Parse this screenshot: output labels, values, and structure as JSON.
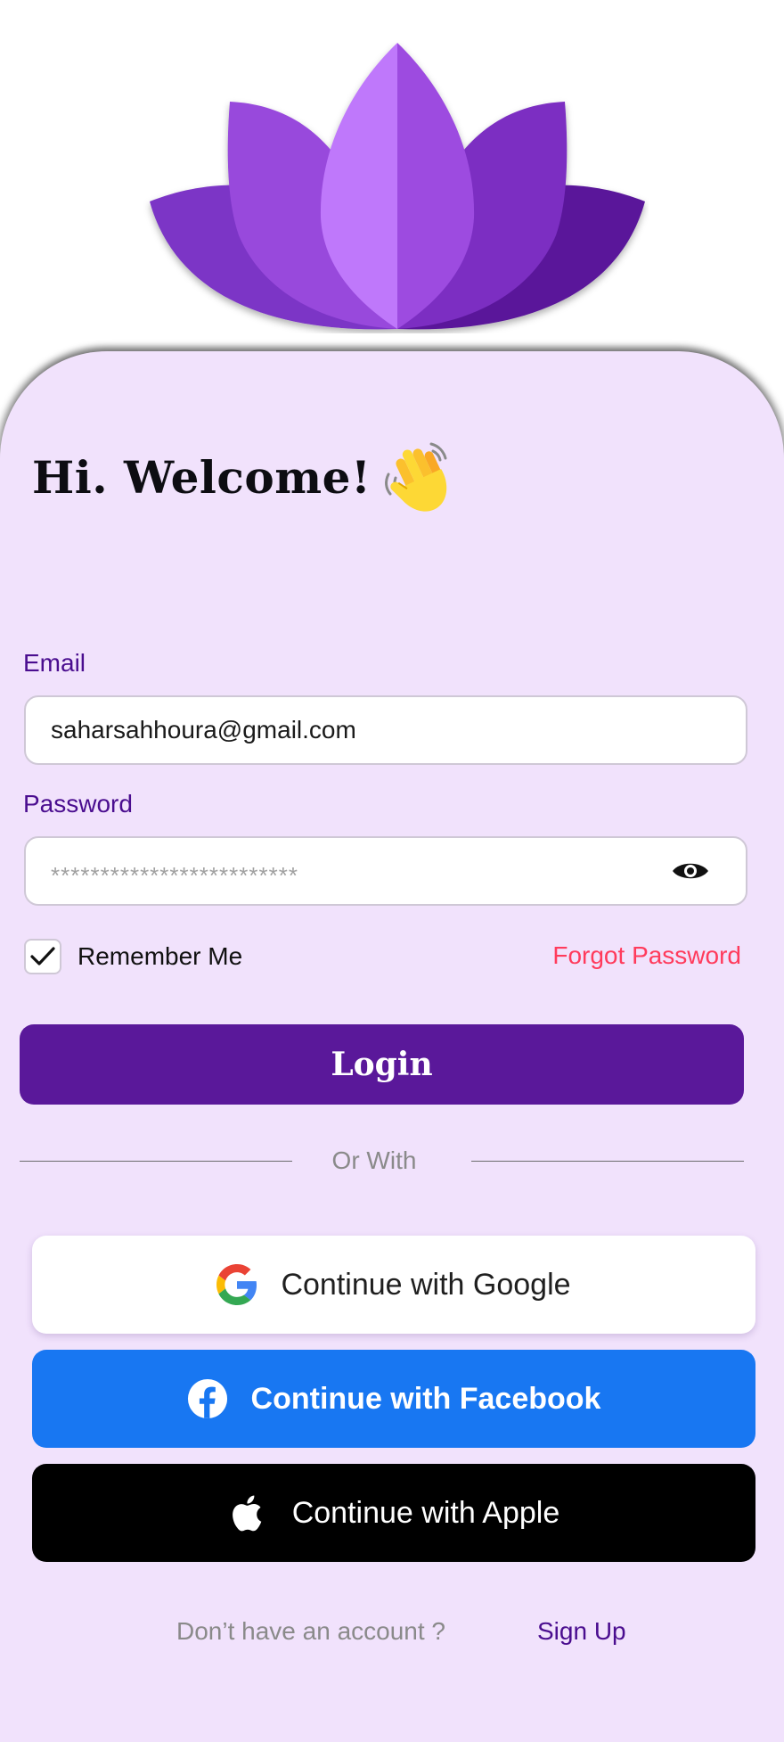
{
  "header": {
    "title": "Hi. Welcome!",
    "logo_icon": "lotus-icon",
    "wave_icon": "waving-hand-icon"
  },
  "form": {
    "email_label": "Email",
    "email_value": "saharsahhoura@gmail.com",
    "password_label": "Password",
    "password_mask": "*************************",
    "password_toggle_icon": "eye-icon",
    "remember_label": "Remember Me",
    "remember_checked": true,
    "forgot_label": "Forgot Password",
    "login_label": "Login"
  },
  "divider": {
    "label": "Or With"
  },
  "social": {
    "google_label": "Continue with Google",
    "facebook_label": "Continue with Facebook",
    "apple_label": "Continue with Apple"
  },
  "footer": {
    "prompt": "Don’t have an account ?",
    "signup_label": "Sign Up"
  },
  "colors": {
    "card_background": "#f1e2fc",
    "primary": "#5a189a",
    "label": "#4a0d8f",
    "forgot": "#ff3b5c",
    "facebook": "#1877f2",
    "apple": "#000000"
  }
}
